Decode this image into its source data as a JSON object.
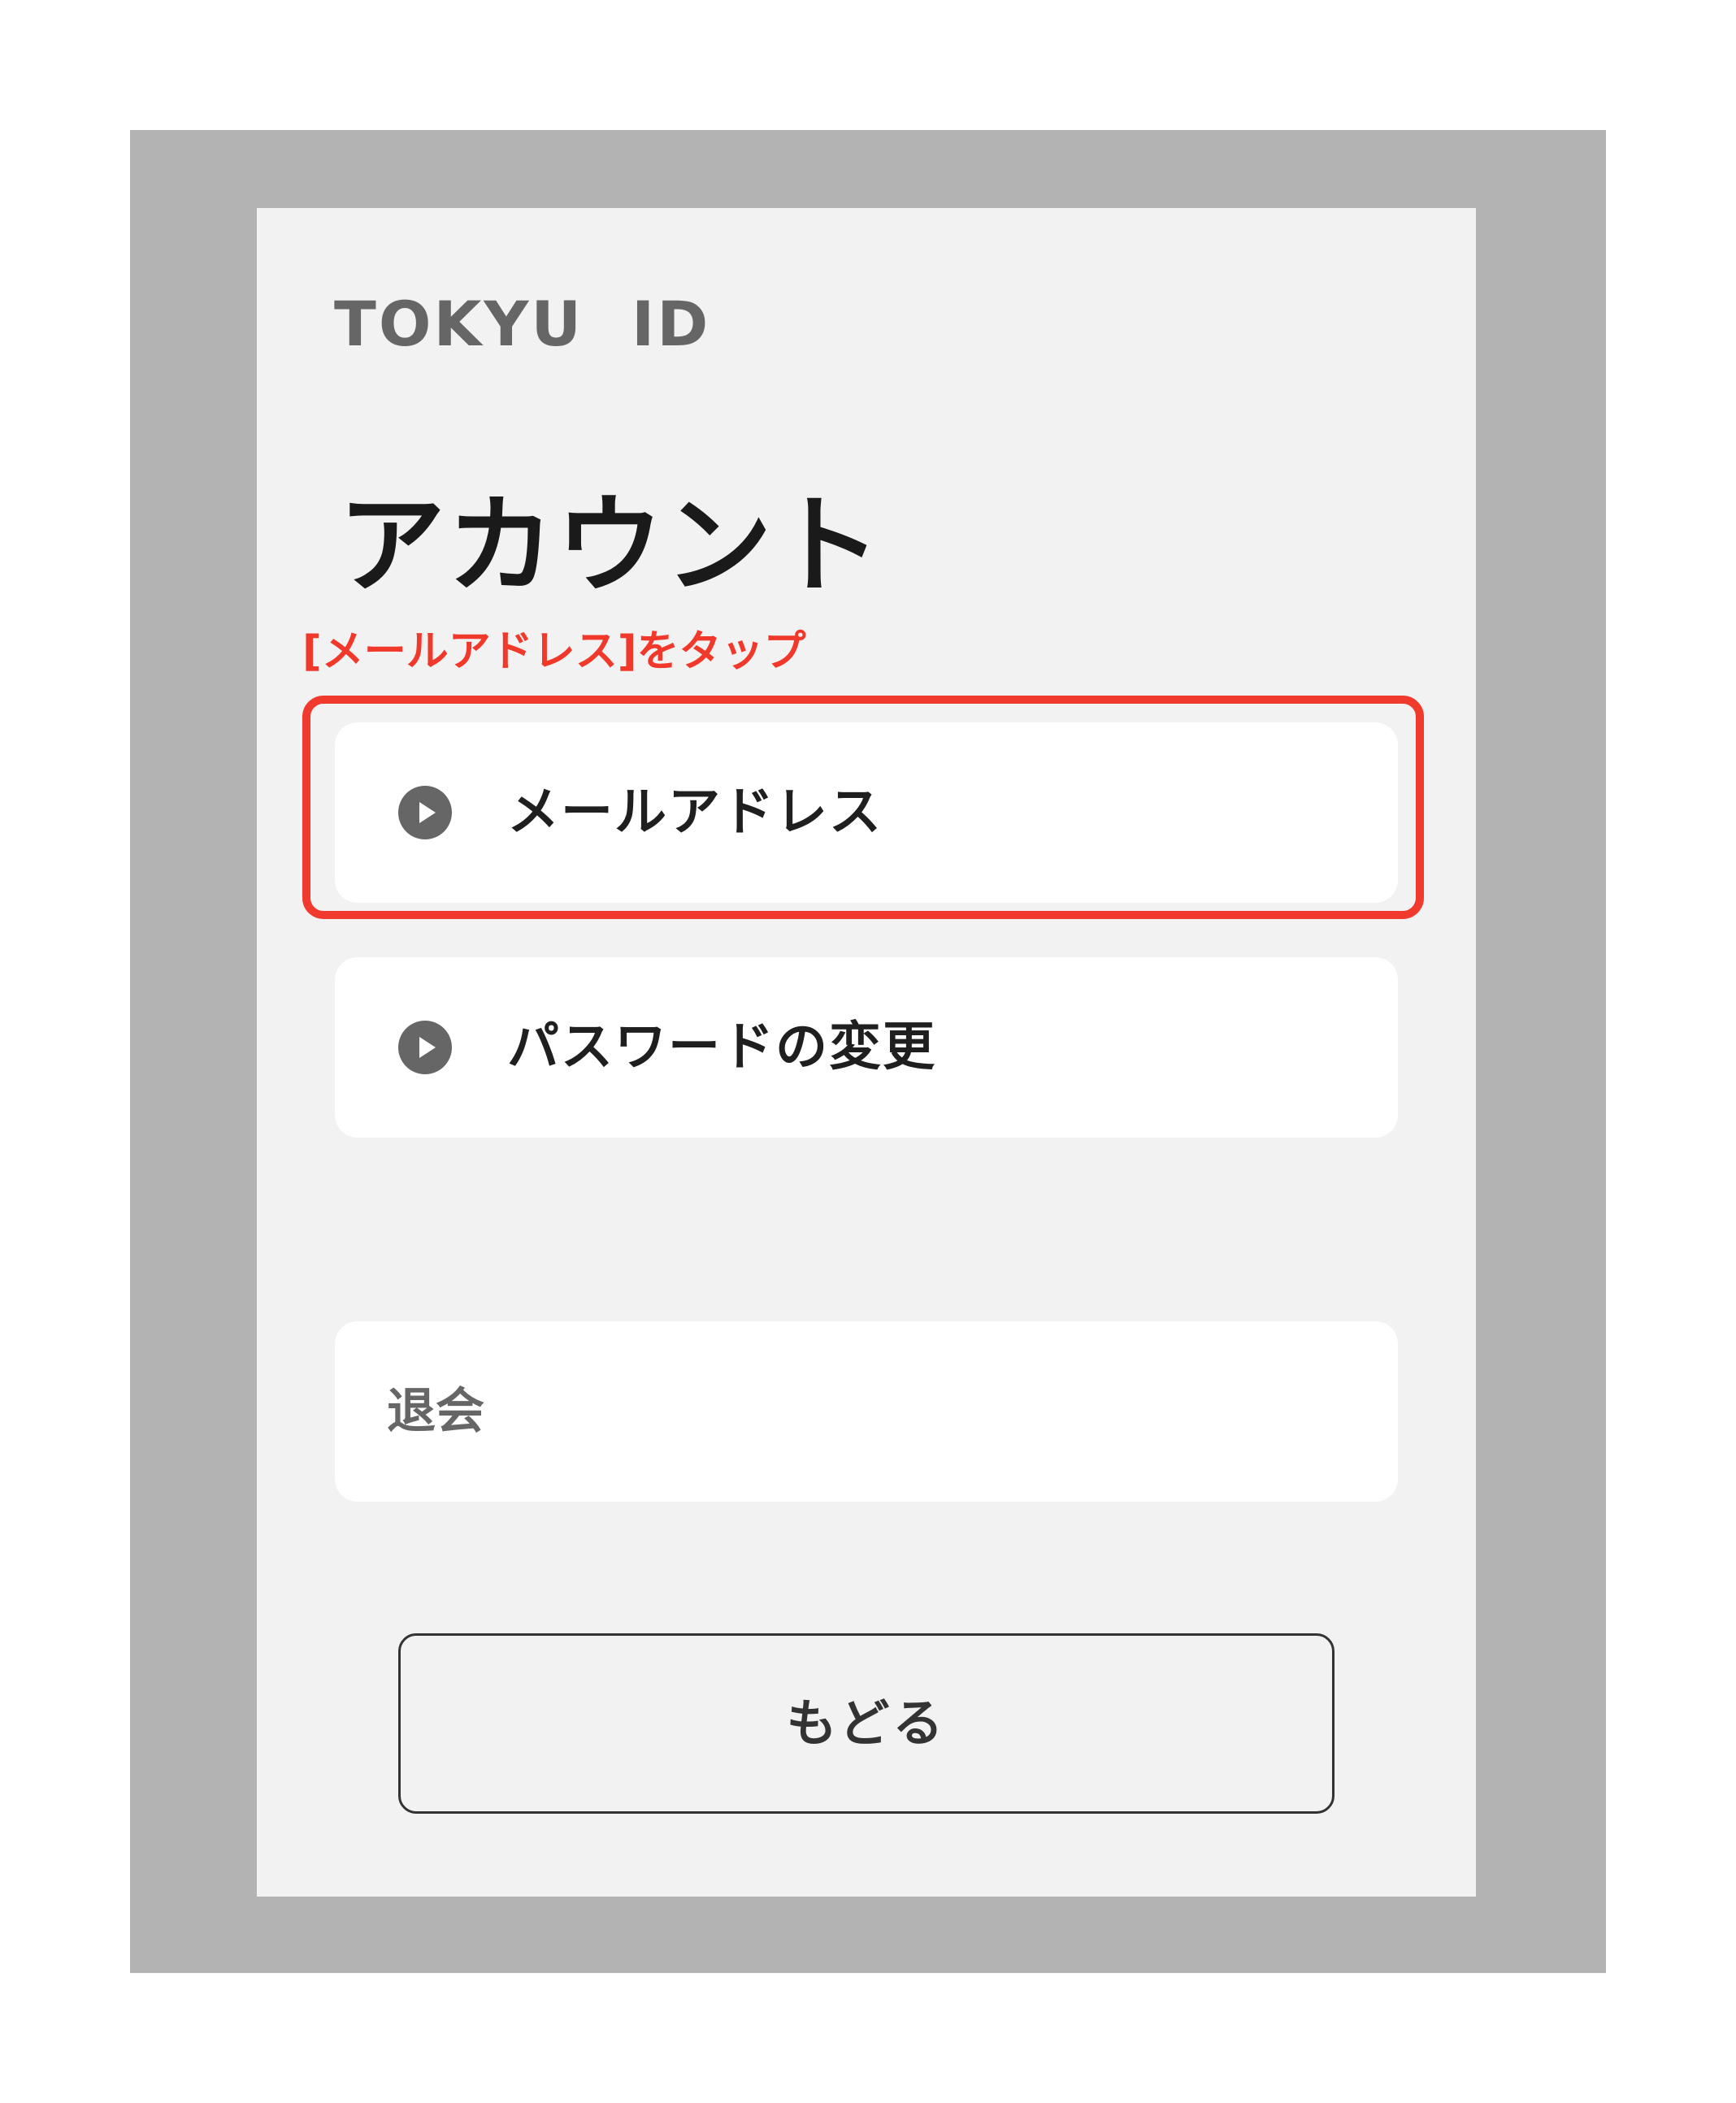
{
  "header": {
    "logo_text": "TOKYU  ID"
  },
  "page": {
    "title": "アカウント"
  },
  "annotation": {
    "text": "[メールアドレス]をタップ",
    "color": "#f03a2e"
  },
  "menu": {
    "items": [
      {
        "label": "メールアドレス",
        "icon": "play-circle-icon"
      },
      {
        "label": "パスワードの変更",
        "icon": "play-circle-icon"
      }
    ],
    "withdraw_label": "退会"
  },
  "footer": {
    "back_label": "もどる"
  },
  "colors": {
    "outer_frame": "#b3b3b3",
    "screen_background": "#f2f2f2",
    "card_background": "#ffffff",
    "icon": "#666666"
  }
}
